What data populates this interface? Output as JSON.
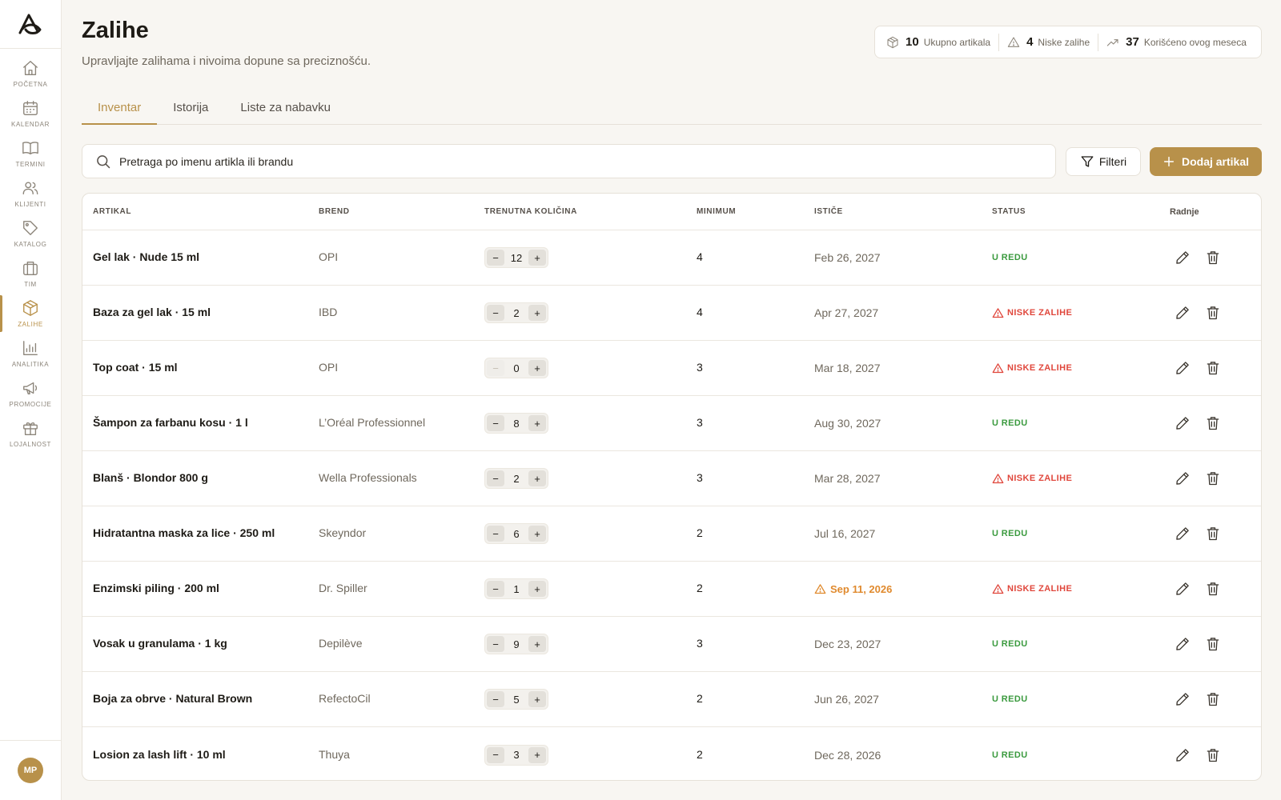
{
  "app": {
    "logo_icon": "brand-logo-icon"
  },
  "sidebar": {
    "items": [
      {
        "label": "POČETNA",
        "icon": "home-icon"
      },
      {
        "label": "KALENDAR",
        "icon": "calendar-icon"
      },
      {
        "label": "TERMINI",
        "icon": "book-icon"
      },
      {
        "label": "KLIJENTI",
        "icon": "users-icon"
      },
      {
        "label": "KATALOG",
        "icon": "tag-icon"
      },
      {
        "label": "TIM",
        "icon": "briefcase-icon"
      },
      {
        "label": "ZALIHE",
        "icon": "package-icon",
        "active": true
      },
      {
        "label": "ANALITIKA",
        "icon": "bar-chart-icon"
      },
      {
        "label": "PROMOCIJE",
        "icon": "megaphone-icon"
      },
      {
        "label": "LOJALNOST",
        "icon": "gift-icon"
      }
    ],
    "user_initials": "MP"
  },
  "header": {
    "title": "Zalihe",
    "subtitle": "Upravljajte zalihama i nivoima dopune sa preciznošću."
  },
  "stats": {
    "total": {
      "value": "10",
      "label": "Ukupno artikala"
    },
    "low": {
      "value": "4",
      "label": "Niske zalihe"
    },
    "used": {
      "value": "37",
      "label": "Korišćeno ovog meseca"
    }
  },
  "tabs": [
    {
      "label": "Inventar",
      "active": true
    },
    {
      "label": "Istorija"
    },
    {
      "label": "Liste za nabavku"
    }
  ],
  "toolbar": {
    "search_placeholder": "Pretraga po imenu artikla ili brandu",
    "filter_label": "Filteri",
    "add_label": "Dodaj artikal"
  },
  "table": {
    "headers": {
      "item": "ARTIKAL",
      "brand": "BREND",
      "qty": "TRENUTNA KOLIČINA",
      "min": "MINIMUM",
      "expires": "ISTIČE",
      "status": "STATUS",
      "actions": "Radnje"
    },
    "stepper_minus": "−",
    "stepper_plus": "+",
    "rows": [
      {
        "name": "Gel lak · Nude 15 ml",
        "brand": "OPI",
        "qty": "12",
        "min": "4",
        "expires": "Feb 26, 2027",
        "status": "U REDU",
        "state": "ok"
      },
      {
        "name": "Baza za gel lak · 15 ml",
        "brand": "IBD",
        "qty": "2",
        "min": "4",
        "expires": "Apr 27, 2027",
        "status": "NISKE ZALIHE",
        "state": "low"
      },
      {
        "name": "Top coat · 15 ml",
        "brand": "OPI",
        "qty": "0",
        "min": "3",
        "expires": "Mar 18, 2027",
        "status": "NISKE ZALIHE",
        "state": "low"
      },
      {
        "name": "Šampon za farbanu kosu · 1 l",
        "brand": "L’Oréal Professionnel",
        "qty": "8",
        "min": "3",
        "expires": "Aug 30, 2027",
        "status": "U REDU",
        "state": "ok"
      },
      {
        "name": "Blanš · Blondor 800 g",
        "brand": "Wella Professionals",
        "qty": "2",
        "min": "3",
        "expires": "Mar 28, 2027",
        "status": "NISKE ZALIHE",
        "state": "low"
      },
      {
        "name": "Hidratantna maska za lice · 250 ml",
        "brand": "Skeyndor",
        "qty": "6",
        "min": "2",
        "expires": "Jul 16, 2027",
        "status": "U REDU",
        "state": "ok"
      },
      {
        "name": "Enzimski piling · 200 ml",
        "brand": "Dr. Spiller",
        "qty": "1",
        "min": "2",
        "expires": "Sep 11, 2026",
        "expires_warning": true,
        "status": "NISKE ZALIHE",
        "state": "low"
      },
      {
        "name": "Vosak u granulama · 1 kg",
        "brand": "Depilève",
        "qty": "9",
        "min": "3",
        "expires": "Dec 23, 2027",
        "status": "U REDU",
        "state": "ok"
      },
      {
        "name": "Boja za obrve · Natural Brown",
        "brand": "RefectoCil",
        "qty": "5",
        "min": "2",
        "expires": "Jun 26, 2027",
        "status": "U REDU",
        "state": "ok"
      },
      {
        "name": "Losion za lash lift · 10 ml",
        "brand": "Thuya",
        "qty": "3",
        "min": "2",
        "expires": "Dec 28, 2026",
        "status": "U REDU",
        "state": "ok"
      }
    ]
  },
  "colors": {
    "accent": "#b8914a",
    "ok": "#3a9a3e",
    "low": "#e0473c",
    "warning": "#e08a2e"
  }
}
